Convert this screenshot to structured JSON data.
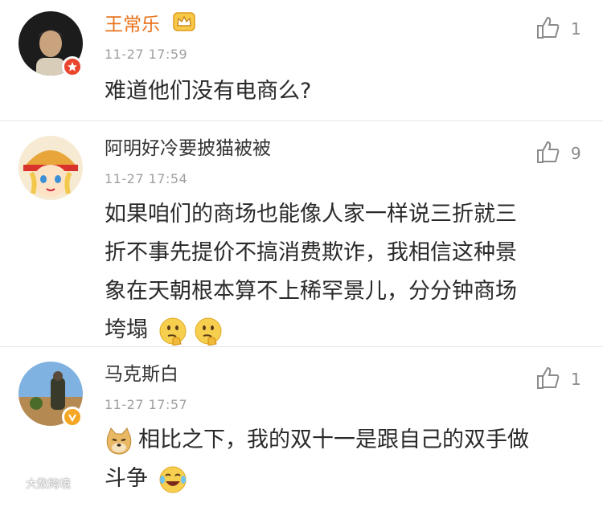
{
  "comments": [
    {
      "username": "王常乐",
      "timestamp": "11-27 17:59",
      "likes": "1",
      "username_color": "#e8731a",
      "lines": [
        "难道他们没有电商么?"
      ]
    },
    {
      "username": "阿明好冷要披猫被被",
      "timestamp": "11-27 17:54",
      "likes": "9",
      "username_color": "#333333",
      "lines": [
        "如果咱们的商场也能像人家一样说三折就三",
        "折不事先提价不搞消费欺诈，我相信这种景",
        "象在天朝根本算不上稀罕景儿，分分钟商场",
        "垮塌"
      ]
    },
    {
      "username": "马克斯白",
      "timestamp": "11-27 17:57",
      "likes": "1",
      "username_color": "#333333",
      "lines": [
        "相比之下，我的双十一是跟自己的双手做",
        "斗争"
      ]
    }
  ],
  "watermark": "大数跨境",
  "icons": {
    "like": "thumbs-up-icon",
    "vip": "crown-icon",
    "badge_red": "star-badge-icon",
    "badge_gold": "verified-v-icon",
    "emoji_think": "thinking-face-emoji",
    "emoji_doge": "doge-emoji",
    "emoji_laugh": "laugh-cry-emoji"
  },
  "colors": {
    "accent_orange": "#e8731a",
    "badge_red": "#e8452c",
    "badge_gold": "#f5a623",
    "divider": "#e6e6e6",
    "meta_gray": "#a0a0a0"
  }
}
